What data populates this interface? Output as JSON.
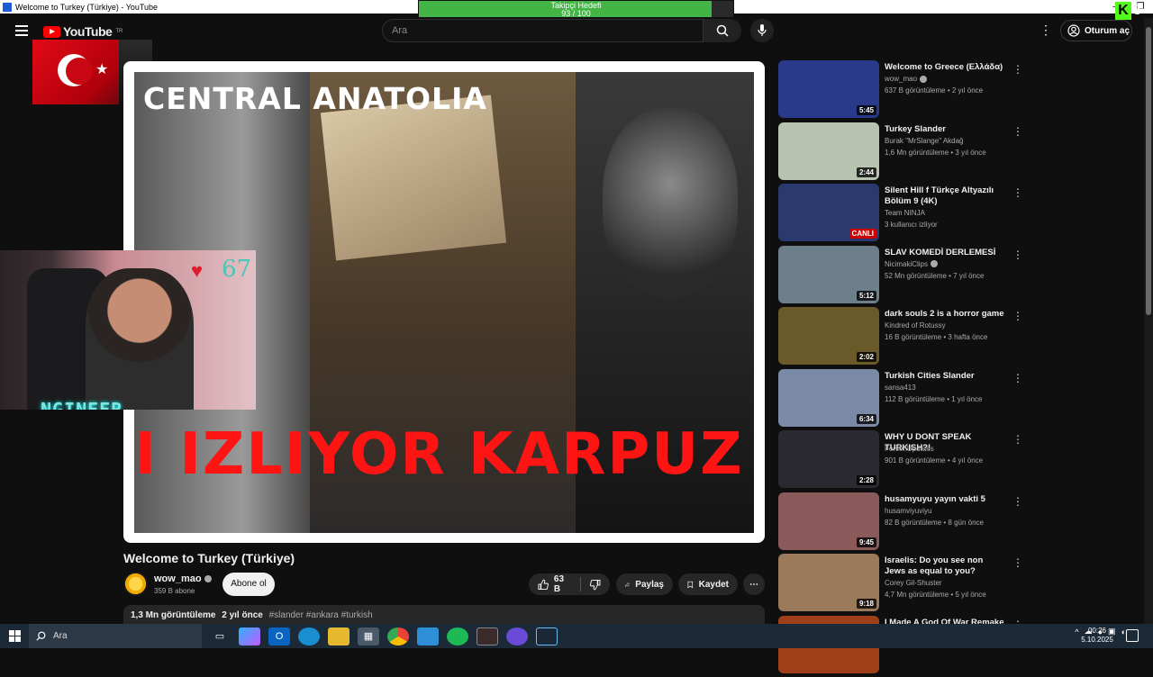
{
  "window": {
    "title": "Welcome to Turkey (Türkiye) - YouTube",
    "minimize": "–",
    "restore": "❐"
  },
  "overlay": {
    "goal_label": "Takipçi Hedefi",
    "goal_value": "93 / 100",
    "goal_fraction": 0.93,
    "kick_logo": "K",
    "kick_count": "8",
    "heart_count": "67",
    "cam_brand": "NGINEER"
  },
  "header": {
    "logo_text": "YouTube",
    "logo_region": "TR",
    "search_placeholder": "Ara",
    "signin_label": "Oturum aç",
    "kebab": "⋮"
  },
  "video": {
    "frame_caption_top": "CENTRAL ANATOLIA",
    "frame_caption_bottom": "I IZLIYOR  KARPUZ SAT",
    "title": "Welcome to Turkey (Türkiye)",
    "channel_name": "wow_mao",
    "channel_subs": "359 B abone",
    "subscribe_label": "Abone ol",
    "likes": "63 B",
    "share_label": "Paylaş",
    "save_label": "Kaydet",
    "more": "⋯",
    "views": "1,3 Mn görüntüleme",
    "age": "2 yıl önce",
    "tags": "#slander #ankara #turkish"
  },
  "recommendations": [
    {
      "title": "Welcome to Greece (Ελλάδα)",
      "channel": "wow_mao",
      "verified": true,
      "meta": "637 B görüntüleme • 2 yıl önce",
      "duration": "5:45",
      "thumb": "#2a3a8a"
    },
    {
      "title": "Turkey Slander",
      "channel": "Burak \"MrSlange\" Akdağ",
      "verified": false,
      "meta": "1,6 Mn görüntüleme • 3 yıl önce",
      "duration": "2:44",
      "thumb": "#b9c4b0"
    },
    {
      "title": "Silent Hill f Türkçe Altyazılı Bölüm 9 (4K)",
      "channel": "Team NINJA",
      "verified": false,
      "meta": "3 kullanıcı izliyor",
      "duration": "CANLI",
      "thumb": "#2b3a6e"
    },
    {
      "title": "SLAV KOMEDİ DERLEMESİ",
      "channel": "NicimakiClips",
      "verified": true,
      "meta": "52 Mn görüntüleme • 7 yıl önce",
      "duration": "5:12",
      "thumb": "#6e7f8c"
    },
    {
      "title": "dark souls 2 is a horror game",
      "channel": "Kindred of Rotussy",
      "verified": false,
      "meta": "16 B görüntüleme • 3 hafta önce",
      "duration": "2:02",
      "thumb": "#6a5a2a"
    },
    {
      "title": "Turkish Cities Slander",
      "channel": "sansa413",
      "verified": false,
      "meta": "112 B görüntüleme • 1 yıl önce",
      "duration": "6:34",
      "thumb": "#7a8aa6"
    },
    {
      "title": "WHY U DONT SPEAK TURKISH?!",
      "channel": "ForsenUpdates",
      "verified": false,
      "meta": "901 B görüntüleme • 4 yıl önce",
      "duration": "2:28",
      "thumb": "#2a2a30"
    },
    {
      "title": "husamyuyu yayın vakti 5",
      "channel": "husamviyuviyu",
      "verified": false,
      "meta": "82 B görüntüleme • 8 gün önce",
      "duration": "9:45",
      "thumb": "#8a5a5a"
    },
    {
      "title": "Israelis: Do you see non Jews as equal to you?",
      "channel": "Corey Gil-Shuster",
      "verified": false,
      "meta": "4,7 Mn görüntüleme • 5 yıl önce",
      "duration": "9:18",
      "thumb": "#9a7a5a"
    },
    {
      "title": "I Made A God Of War Remake",
      "channel": "",
      "verified": false,
      "meta": "",
      "duration": "",
      "thumb": "#a0401a"
    }
  ],
  "taskbar": {
    "search_label": "Ara",
    "time": "00:26",
    "date": "5.10.2025"
  },
  "colors": {
    "bg": "#0f0f0f",
    "accent": "#ff0000",
    "goal_fill": "#43b545"
  }
}
